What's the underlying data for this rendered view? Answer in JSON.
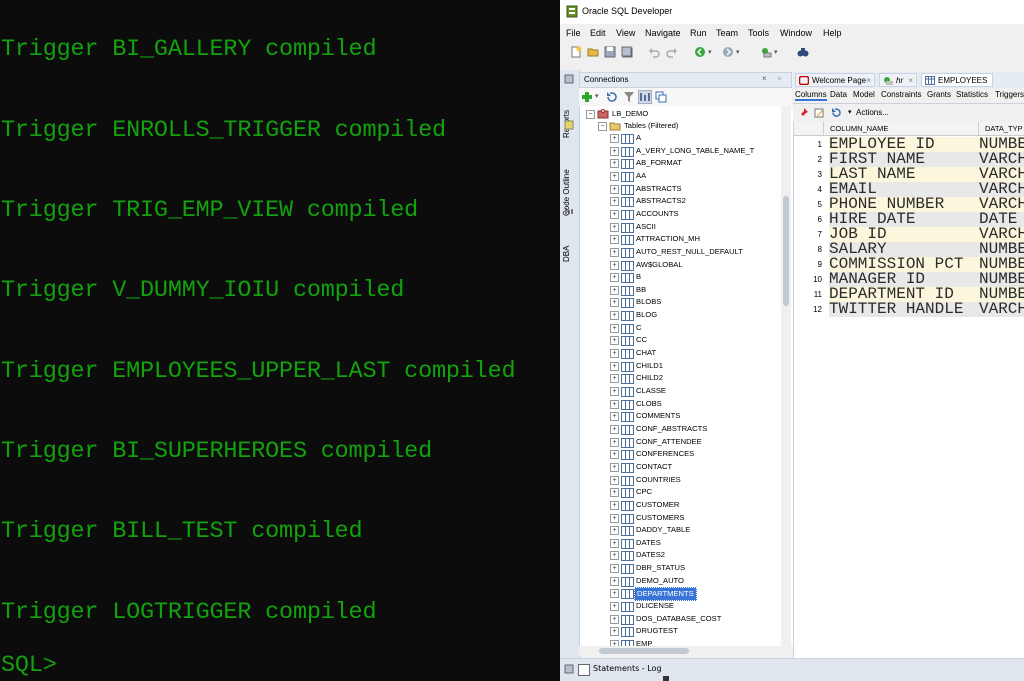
{
  "terminal": {
    "lines": [
      "Trigger BI_GALLERY compiled",
      "Trigger ENROLLS_TRIGGER compiled",
      "Trigger TRIG_EMP_VIEW compiled",
      "Trigger V_DUMMY_IOIU compiled",
      "Trigger EMPLOYEES_UPPER_LAST compiled",
      "Trigger BI_SUPERHEROES compiled",
      "Trigger BILL_TEST compiled",
      "Trigger LOGTRIGGER compiled"
    ],
    "prompt": "SQL>"
  },
  "window": {
    "title": "Oracle SQL Developer"
  },
  "menu": [
    "File",
    "Edit",
    "View",
    "Navigate",
    "Run",
    "Team",
    "Tools",
    "Window",
    "Help"
  ],
  "side_tabs": [
    "Reports",
    "Code Outline",
    "DBA"
  ],
  "connections": {
    "title": "Connections",
    "connection_name": "LB_DEMO",
    "tables_node": "Tables (Filtered)",
    "tables": [
      "A",
      "A_VERY_LONG_TABLE_NAME_T",
      "AB_FORMAT",
      "AA",
      "ABSTRACTS",
      "ABSTRACTS2",
      "ACCOUNTS",
      "ASCII",
      "ATTRACTION_MH",
      "AUTO_REST_NULL_DEFAULT",
      "AW$GLOBAL",
      "B",
      "BB",
      "BLOBS",
      "BLOG",
      "C",
      "CC",
      "CHAT",
      "CHILD1",
      "CHILD2",
      "CLASSE",
      "CLOBS",
      "COMMENTS",
      "CONF_ABSTRACTS",
      "CONF_ATTENDEE",
      "CONFERENCES",
      "CONTACT",
      "COUNTRIES",
      "CPC",
      "CUSTOMER",
      "CUSTOMERS",
      "DADDY_TABLE",
      "DATES",
      "DATES2",
      "DBR_STATUS",
      "DEMO_AUTO",
      "DEPARTMENTS",
      "DLICENSE",
      "DOS_DATABASE_COST",
      "DRUGTEST",
      "EMP"
    ],
    "selected": "DEPARTMENTS"
  },
  "editor": {
    "tabs": [
      "Welcome Page",
      "hr",
      "EMPLOYEES"
    ],
    "subtabs": [
      "Columns",
      "Data",
      "Model",
      "Constraints",
      "Grants",
      "Statistics",
      "Triggers"
    ],
    "actions_label": "Actions...",
    "columns_header": [
      "COLUMN_NAME",
      "DATA_TYP"
    ],
    "rows": [
      {
        "n": "1",
        "name": "EMPLOYEE ID",
        "type": "NUMBE"
      },
      {
        "n": "2",
        "name": "FIRST NAME",
        "type": "VARCH"
      },
      {
        "n": "3",
        "name": "LAST NAME",
        "type": "VARCH"
      },
      {
        "n": "4",
        "name": "EMAIL",
        "type": "VARCH"
      },
      {
        "n": "5",
        "name": "PHONE NUMBER",
        "type": "VARCH"
      },
      {
        "n": "6",
        "name": "HIRE DATE",
        "type": "DATE"
      },
      {
        "n": "7",
        "name": "JOB ID",
        "type": "VARCH"
      },
      {
        "n": "8",
        "name": "SALARY",
        "type": "NUMBE"
      },
      {
        "n": "9",
        "name": "COMMISSION PCT",
        "type": "NUMBE"
      },
      {
        "n": "10",
        "name": "MANAGER ID",
        "type": "NUMBE"
      },
      {
        "n": "11",
        "name": "DEPARTMENT ID",
        "type": "NUMBE"
      },
      {
        "n": "12",
        "name": "TWITTER HANDLE",
        "type": "VARCH"
      }
    ]
  },
  "bottom": {
    "statements_log": "Statements - Log"
  },
  "colors": {
    "terminal_text": "#13a10e",
    "terminal_bg": "#0c0c0c",
    "selection": "#3875d7"
  }
}
